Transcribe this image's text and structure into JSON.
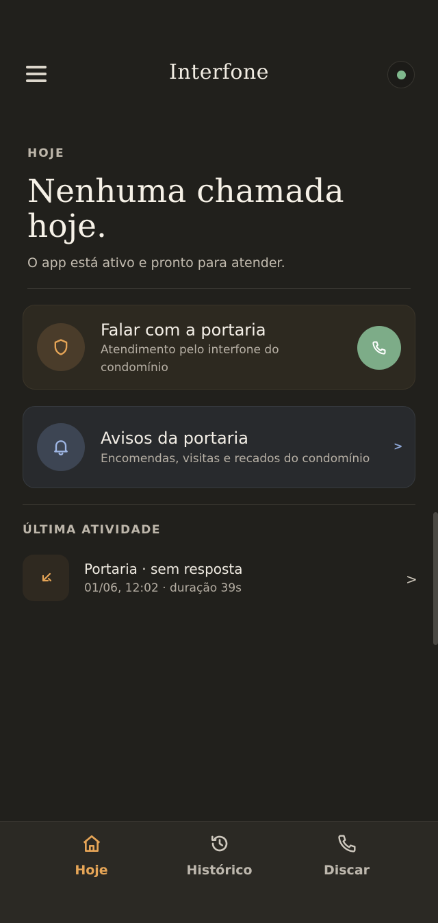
{
  "app_bar": {
    "title": "Interfone",
    "menu_icon": "hamburger-menu-icon",
    "status_color": "#7fb88d"
  },
  "today": {
    "eyebrow": "HOJE",
    "headline": "Nenhuma chamada hoje.",
    "subline": "O app está ativo e pronto para atender."
  },
  "cards": {
    "portaria": {
      "title": "Falar com a portaria",
      "subtitle": "Atendimento pelo interfone do condomínio",
      "icon": "shield-icon",
      "action_icon": "phone-icon"
    },
    "avisos": {
      "title": "Avisos da portaria",
      "subtitle": "Encomendas, visitas e recados do condomínio",
      "icon": "bell-icon",
      "chevron": ">"
    }
  },
  "activity": {
    "heading": "ÚLTIMA ATIVIDADE",
    "items": [
      {
        "title": "Portaria · sem resposta",
        "meta": "01/06, 12:02 · duração 39s",
        "icon": "missed-call-icon",
        "chevron": ">"
      }
    ]
  },
  "bottom_nav": {
    "items": [
      {
        "label": "Hoje",
        "icon": "home-icon",
        "active": true
      },
      {
        "label": "Histórico",
        "icon": "history-icon",
        "active": false
      },
      {
        "label": "Discar",
        "icon": "phone-icon",
        "active": false
      }
    ]
  },
  "colors": {
    "background": "#21201c",
    "accent": "#e6a557",
    "call_green": "#7dac88",
    "notice_blue": "#8ea7d6"
  }
}
